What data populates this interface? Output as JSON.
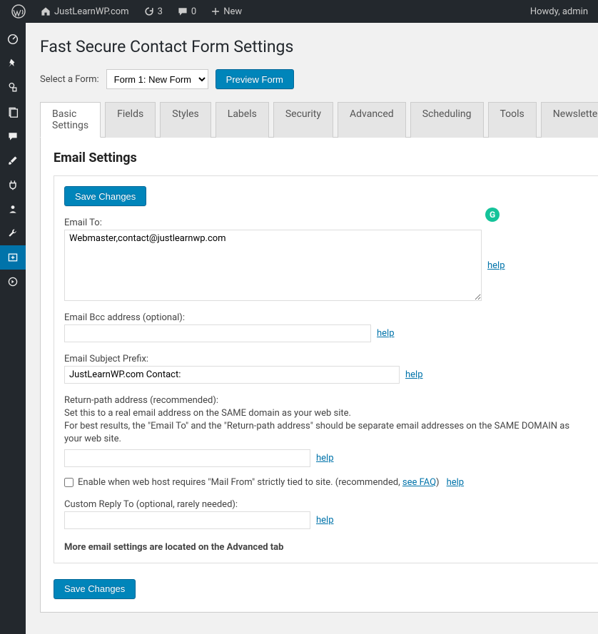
{
  "topbar": {
    "site_name": "JustLearnWP.com",
    "updates_count": "3",
    "comments_count": "0",
    "new_label": "New",
    "howdy": "Howdy, admin"
  },
  "page": {
    "title": "Fast Secure Contact Form Settings",
    "select_form_label": "Select a Form:",
    "form_selected": "Form 1: New Form",
    "preview_button": "Preview Form"
  },
  "tabs": [
    "Basic Settings",
    "Fields",
    "Styles",
    "Labels",
    "Security",
    "Advanced",
    "Scheduling",
    "Tools",
    "Newsletter"
  ],
  "section": {
    "title": "Email Settings",
    "save_button": "Save Changes"
  },
  "fields": {
    "email_to_label": "Email To:",
    "email_to_value": "Webmaster,contact@justlearnwp.com",
    "bcc_label": "Email Bcc address (optional):",
    "bcc_value": "",
    "subject_label": "Email Subject Prefix:",
    "subject_value": "JustLearnWP.com Contact:",
    "return_path_label": "Return-path address (recommended):",
    "return_path_note1": "Set this to a real email address on the SAME domain as your web site.",
    "return_path_note2": "For best results, the \"Email To\" and the \"Return-path address\" should be separate email addresses on the SAME DOMAIN as your web site.",
    "return_path_value": "",
    "mailfrom_checkbox_label_pre": "Enable when web host requires \"Mail From\" strictly tied to site. (recommended, ",
    "mailfrom_checkbox_faq": "see FAQ",
    "mailfrom_checkbox_label_post": ")",
    "custom_replyto_label": "Custom Reply To (optional, rarely needed):",
    "custom_replyto_value": "",
    "more_note": "More email settings are located on the Advanced tab",
    "help_text": "help"
  },
  "grammar_badge": "G"
}
